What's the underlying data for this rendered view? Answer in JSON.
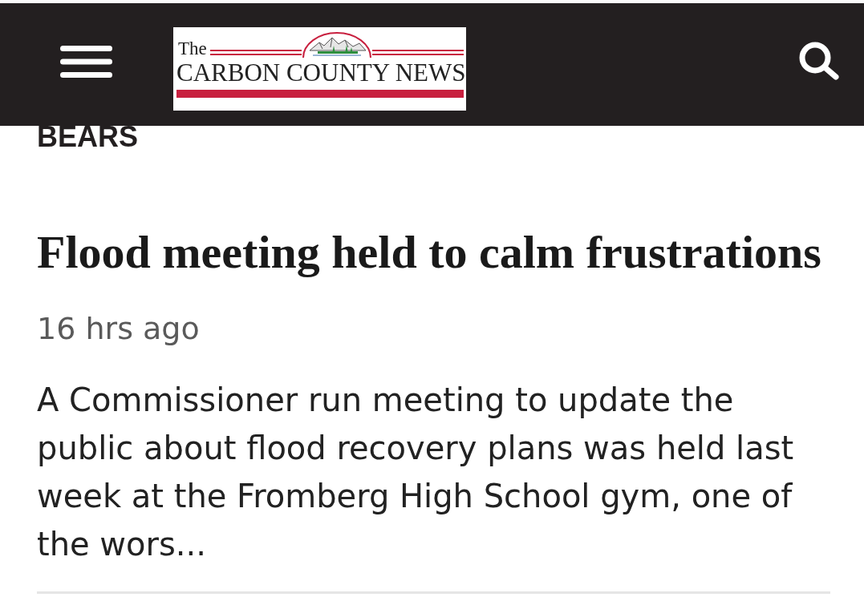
{
  "header": {
    "logo": {
      "prefix": "The",
      "name": "CARBON COUNTY NEWS"
    }
  },
  "section_label": "BEARS",
  "article": {
    "headline": "Flood meeting held to calm frustrations",
    "time": "16 hrs ago",
    "summary": "A Commissioner run meeting to update the public about flood recovery plans was held last week at the Fromberg High School gym, one of the wors..."
  }
}
